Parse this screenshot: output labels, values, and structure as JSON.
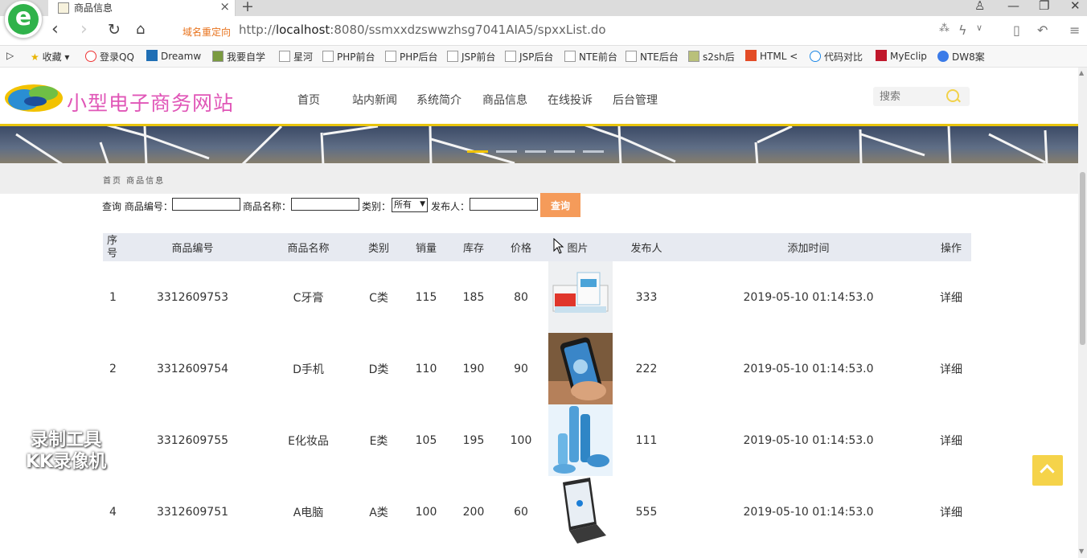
{
  "browser": {
    "tab_title": "商品信息",
    "redirect_label": "域名重定向",
    "url_prefix": "http://",
    "url_host": "localhost",
    "url_rest": ":8080/ssmxxdzswwzhsg7041AIA5/spxxList.do",
    "bookmarks": [
      "收藏",
      "登录QQ",
      "Dreamw",
      "我要自学",
      "星河",
      "PHP前台",
      "PHP后台",
      "JSP前台",
      "JSP后台",
      "NTE前台",
      "NTE后台",
      "s2sh后",
      "HTML <",
      "代码对比",
      "MyEclip",
      "DW8案"
    ]
  },
  "site": {
    "title": "小型电子商务网站",
    "menu": [
      "首页",
      "站内新闻",
      "系统简介",
      "商品信息",
      "在线投诉",
      "后台管理"
    ],
    "search_placeholder": "搜索",
    "breadcrumb": "首页 商品信息"
  },
  "query": {
    "prefix": "查询 商品编号：",
    "name_label": "商品名称：",
    "category_label": "类别：",
    "category_value": "所有",
    "publisher_label": "发布人：",
    "button_label": "查询"
  },
  "table": {
    "headers": [
      "序号",
      "商品编号",
      "商品名称",
      "类别",
      "销量",
      "库存",
      "价格",
      "图片",
      "发布人",
      "添加时间",
      "操作"
    ],
    "rows": [
      {
        "seq": "1",
        "code": "3312609753",
        "name": "C牙膏",
        "category": "C类",
        "sales": "115",
        "stock": "185",
        "price": "80",
        "publisher": "333",
        "time": "2019-05-10 01:14:53.0",
        "action": "详细"
      },
      {
        "seq": "2",
        "code": "3312609754",
        "name": "D手机",
        "category": "D类",
        "sales": "110",
        "stock": "190",
        "price": "90",
        "publisher": "222",
        "time": "2019-05-10 01:14:53.0",
        "action": "详细"
      },
      {
        "seq": "",
        "code": "3312609755",
        "name": "E化妆品",
        "category": "E类",
        "sales": "105",
        "stock": "195",
        "price": "100",
        "publisher": "111",
        "time": "2019-05-10 01:14:53.0",
        "action": "详细"
      },
      {
        "seq": "4",
        "code": "3312609751",
        "name": "A电脑",
        "category": "A类",
        "sales": "100",
        "stock": "200",
        "price": "60",
        "publisher": "555",
        "time": "2019-05-10 01:14:53.0",
        "action": "详细"
      }
    ]
  },
  "watermark": {
    "line1": "录制工具",
    "line2": "KK录像机"
  }
}
